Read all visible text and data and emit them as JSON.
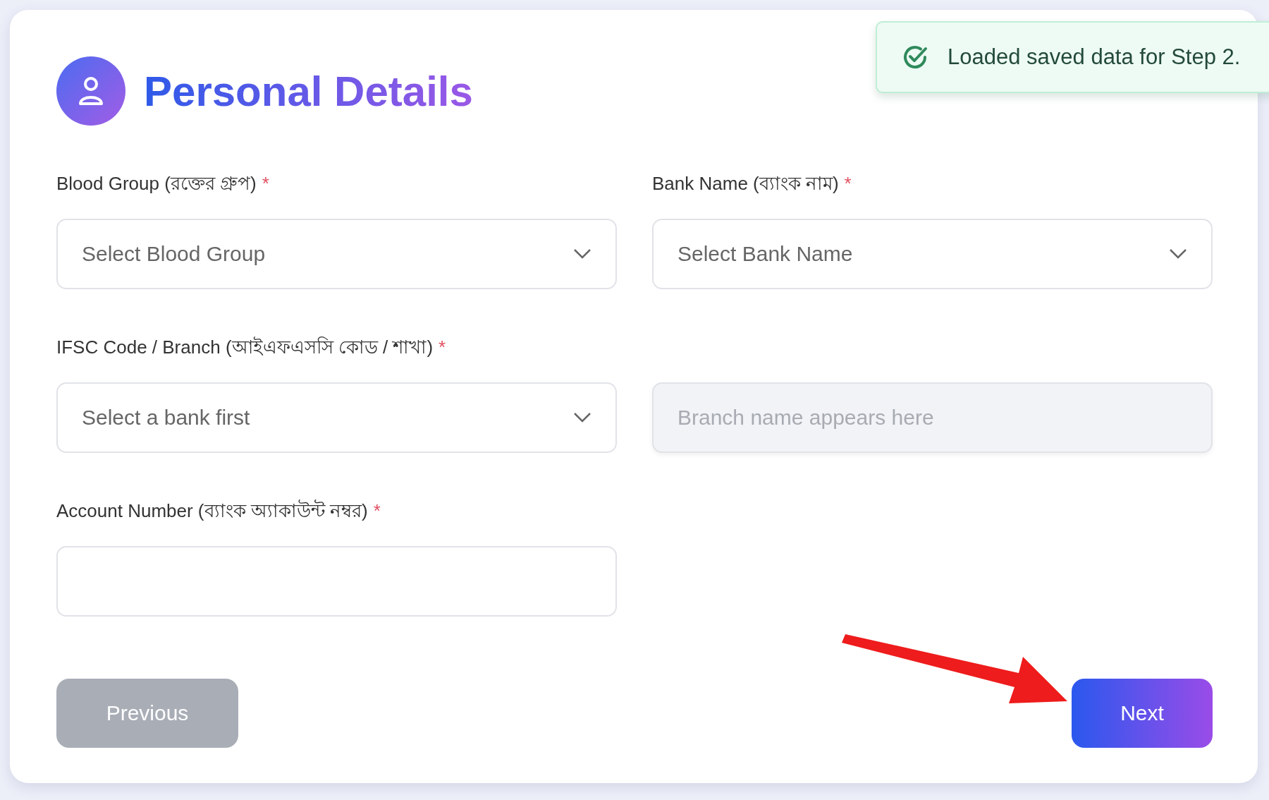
{
  "header": {
    "title": "Personal Details"
  },
  "toast": {
    "message": "Loaded saved data for Step 2."
  },
  "fields": [
    {
      "kind": "select",
      "label": "Blood Group (রক্তের গ্রুপ)",
      "asterisk": "*",
      "placeholder": "Select Blood Group"
    },
    {
      "kind": "select",
      "label": "Bank Name (ব্যাংক নাম)",
      "asterisk": "*",
      "placeholder": "Select Bank Name"
    },
    {
      "kind": "select",
      "label": "IFSC Code / Branch (আইএফএসসি কোড / শাখা)",
      "asterisk": "*",
      "placeholder": "Select a bank first"
    },
    {
      "kind": "readonly",
      "placeholder": "Branch name appears here"
    },
    {
      "kind": "text",
      "label": "Account Number (ব্যাংক অ্যাকাউন্ট নম্বর)",
      "asterisk": "*"
    }
  ],
  "buttons": [
    {
      "label": "Previous",
      "disabled": true
    },
    {
      "label": "Next",
      "disabled": false
    }
  ]
}
